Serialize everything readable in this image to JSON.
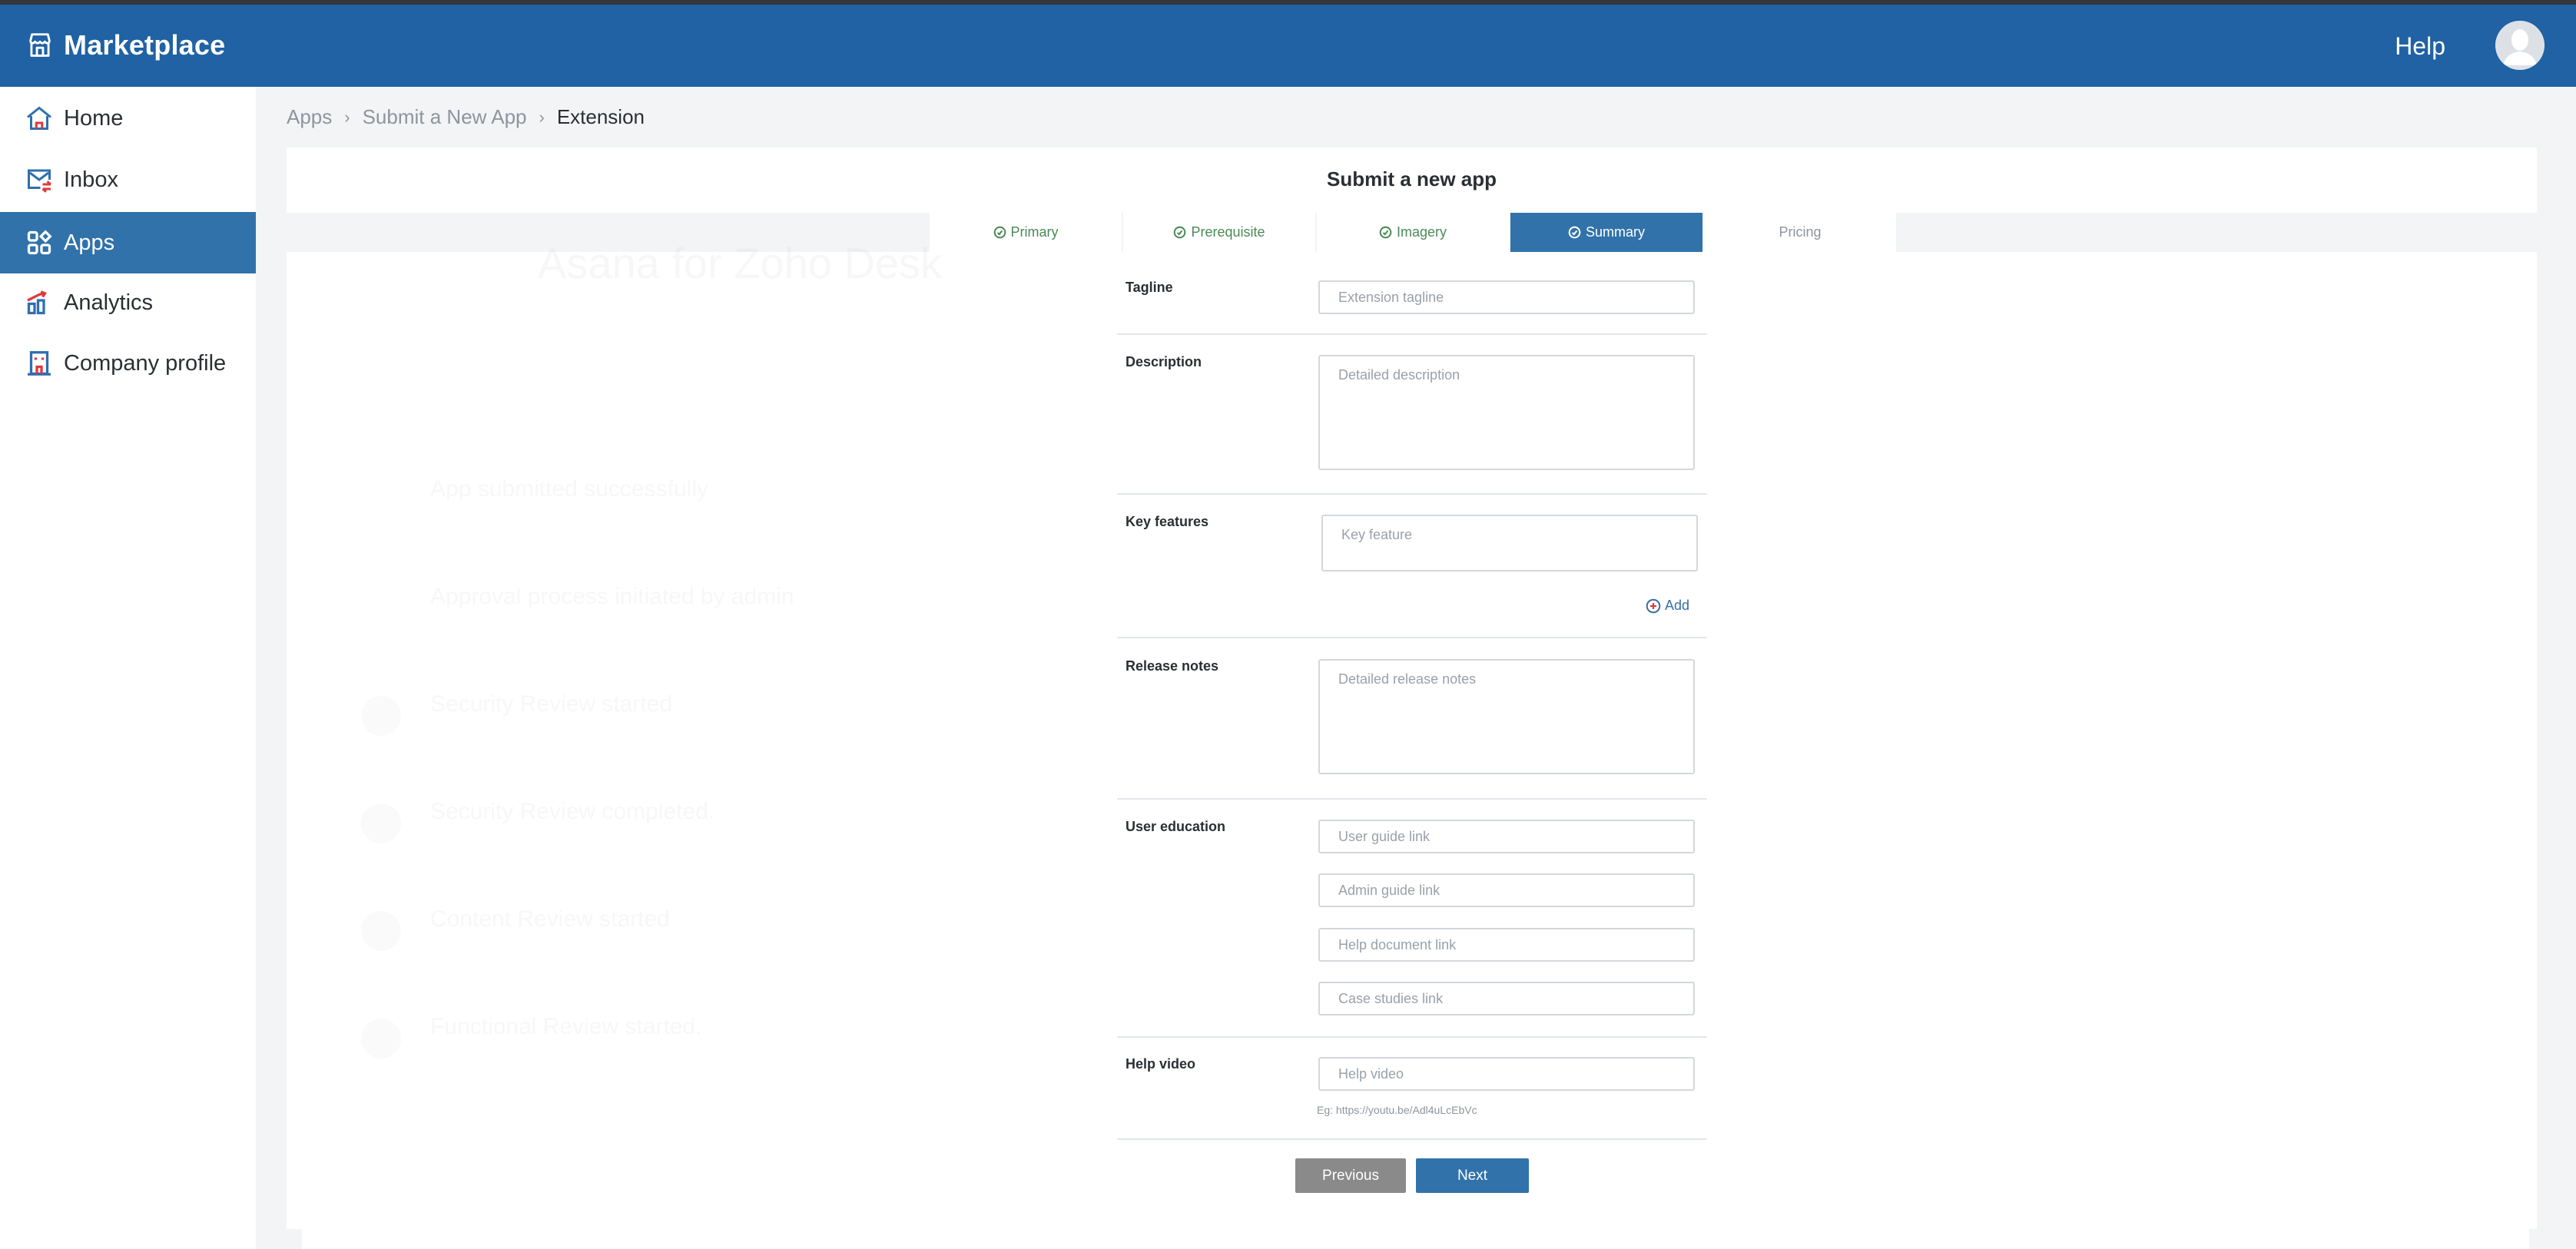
{
  "app": {
    "brand": "Marketplace",
    "help_label": "Help",
    "colors": {
      "header": "#2062a3",
      "active": "#3172aa",
      "done_green": "#4a8a55"
    }
  },
  "sidebar": {
    "items": [
      {
        "label": "Home",
        "icon": "home-icon",
        "active": false
      },
      {
        "label": "Inbox",
        "icon": "inbox-icon",
        "active": false
      },
      {
        "label": "Apps",
        "icon": "apps-icon",
        "active": true
      },
      {
        "label": "Analytics",
        "icon": "analytics-icon",
        "active": false
      },
      {
        "label": "Company profile",
        "icon": "company-icon",
        "active": false
      }
    ]
  },
  "breadcrumb": [
    "Apps",
    "Submit a New App",
    "Extension"
  ],
  "page": {
    "title": "Submit a new app"
  },
  "background_ghost": {
    "title": "Asana for Zoho Desk",
    "items": [
      "App submitted successfully",
      "Approval process initiated by admin",
      "Security Review started",
      "Security Review completed.",
      "Content Review started",
      "Functional Review started."
    ]
  },
  "tabs": [
    {
      "label": "Primary",
      "state": "done"
    },
    {
      "label": "Prerequisite",
      "state": "done"
    },
    {
      "label": "Imagery",
      "state": "done"
    },
    {
      "label": "Summary",
      "state": "active"
    },
    {
      "label": "Pricing",
      "state": "pending"
    }
  ],
  "form": {
    "tagline": {
      "label": "Tagline",
      "placeholder": "Extension tagline",
      "value": ""
    },
    "description": {
      "label": "Description",
      "placeholder": "Detailed description",
      "value": ""
    },
    "key_features": {
      "label": "Key features",
      "placeholder": "Key feature",
      "value": "",
      "add_label": "Add"
    },
    "release_notes": {
      "label": "Release notes",
      "placeholder": "Detailed release notes",
      "value": ""
    },
    "user_education": {
      "label": "User education",
      "fields": [
        {
          "placeholder": "User guide link",
          "value": ""
        },
        {
          "placeholder": "Admin guide link",
          "value": ""
        },
        {
          "placeholder": "Help document link",
          "value": ""
        },
        {
          "placeholder": "Case studies link",
          "value": ""
        }
      ]
    },
    "help_video": {
      "label": "Help video",
      "placeholder": "Help video",
      "value": "",
      "hint": "Eg: https://youtu.be/Adl4uLcEbVc"
    },
    "previous_label": "Previous",
    "next_label": "Next"
  }
}
